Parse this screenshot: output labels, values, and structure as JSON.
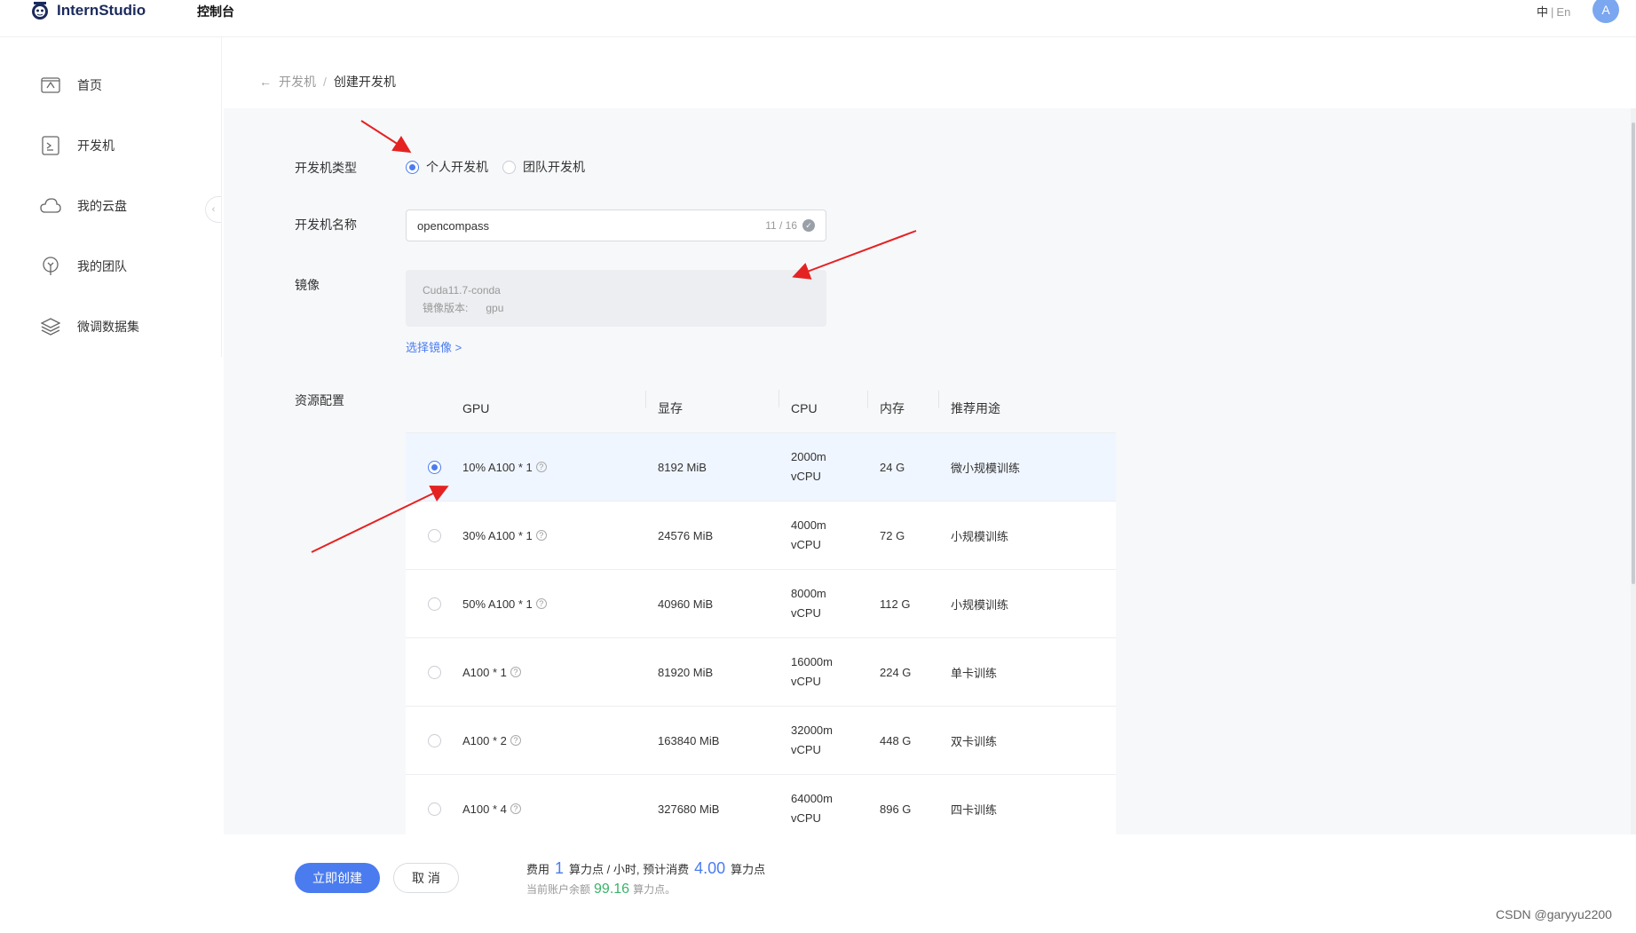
{
  "header": {
    "logo_text": "InternStudio",
    "console": "控制台",
    "lang_zh": "中",
    "lang_sep": "|",
    "lang_en": "En",
    "avatar_letter": "A"
  },
  "sidebar": {
    "items": [
      {
        "label": "首页",
        "icon": "home-icon"
      },
      {
        "label": "开发机",
        "icon": "terminal-icon"
      },
      {
        "label": "我的云盘",
        "icon": "cloud-icon"
      },
      {
        "label": "我的团队",
        "icon": "team-icon"
      },
      {
        "label": "微调数据集",
        "icon": "dataset-layers-icon"
      }
    ]
  },
  "breadcrumb": {
    "back": "←",
    "parent": "开发机",
    "sep": "/",
    "current": "创建开发机"
  },
  "form": {
    "type_label": "开发机类型",
    "type_options": [
      {
        "label": "个人开发机",
        "selected": true
      },
      {
        "label": "团队开发机",
        "selected": false
      }
    ],
    "name_label": "开发机名称",
    "name_value": "opencompass",
    "name_count": "11 / 16",
    "image_label": "镜像",
    "image_name": "Cuda11.7-conda",
    "image_version_label": "镜像版本:",
    "image_version_value": "gpu",
    "select_image": "选择镜像 >",
    "resource_label": "资源配置"
  },
  "table": {
    "headers": [
      "GPU",
      "显存",
      "CPU",
      "内存",
      "推荐用途"
    ],
    "rows": [
      {
        "gpu": "10% A100 * 1",
        "mem": "8192 MiB",
        "cpu_1": "2000m",
        "cpu_2": "vCPU",
        "ram": "24 G",
        "use": "微小规模训练",
        "selected": true
      },
      {
        "gpu": "30% A100 * 1",
        "mem": "24576 MiB",
        "cpu_1": "4000m",
        "cpu_2": "vCPU",
        "ram": "72 G",
        "use": "小规模训练",
        "selected": false
      },
      {
        "gpu": "50% A100 * 1",
        "mem": "40960 MiB",
        "cpu_1": "8000m",
        "cpu_2": "vCPU",
        "ram": "112 G",
        "use": "小规模训练",
        "selected": false
      },
      {
        "gpu": "A100 * 1",
        "mem": "81920 MiB",
        "cpu_1": "16000m",
        "cpu_2": "vCPU",
        "ram": "224 G",
        "use": "单卡训练",
        "selected": false
      },
      {
        "gpu": "A100 * 2",
        "mem": "163840 MiB",
        "cpu_1": "32000m",
        "cpu_2": "vCPU",
        "ram": "448 G",
        "use": "双卡训练",
        "selected": false
      },
      {
        "gpu": "A100 * 4",
        "mem": "327680 MiB",
        "cpu_1": "64000m",
        "cpu_2": "vCPU",
        "ram": "896 G",
        "use": "四卡训练",
        "selected": false
      }
    ]
  },
  "footer": {
    "create_button": "立即创建",
    "cancel_button": "取 消",
    "cost_prefix": "费用",
    "cost_rate": "1",
    "cost_unit": "算力点 / 小时, 预计消费",
    "cost_total": "4.00",
    "cost_total_unit": "算力点",
    "balance_prefix": "当前账户余额",
    "balance_value": "99.16",
    "balance_unit": "算力点。"
  },
  "watermark": "CSDN @garyyu2200",
  "colors": {
    "accent": "#4a7cf0",
    "balance_green": "#3bb36a",
    "selected_row": "#f0f6ff"
  }
}
